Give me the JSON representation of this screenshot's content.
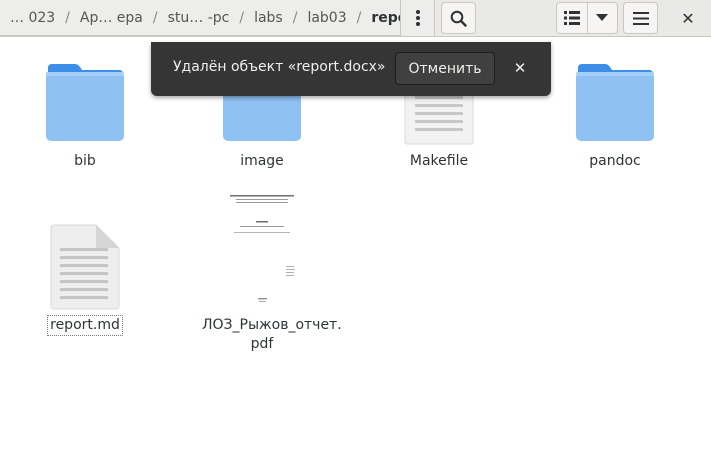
{
  "pathbar": {
    "crumbs": [
      "… 023",
      "Ap… epa",
      "stu… -pc",
      "labs",
      "lab03",
      "report"
    ],
    "separator": "/"
  },
  "header": {
    "path_menu_icon": "vertical-dots-icon",
    "search_icon": "search-icon",
    "view_icon": "list-view-icon",
    "view_dropdown_icon": "chevron-down-icon",
    "menu_icon": "hamburger-icon",
    "close_label": "✕"
  },
  "files": [
    {
      "name": "bib",
      "type": "folder"
    },
    {
      "name": "image",
      "type": "folder"
    },
    {
      "name": "Makefile",
      "type": "text"
    },
    {
      "name": "pandoc",
      "type": "folder"
    },
    {
      "name": "report.md",
      "type": "text",
      "selected": true
    },
    {
      "name": "ЛОЗ_Рыжов_отчет.\npdf",
      "type": "pdf",
      "name_line1": "ЛОЗ_Рыжов_отчет.",
      "name_line2": "pdf"
    }
  ],
  "notification": {
    "message": "Удалён объект «report.docx»",
    "undo_label": "Отменить",
    "close_label": "✕"
  },
  "colors": {
    "folder_top": "#3d8ee6",
    "folder_body": "#8fc1f3",
    "toast_bg": "#353535"
  }
}
